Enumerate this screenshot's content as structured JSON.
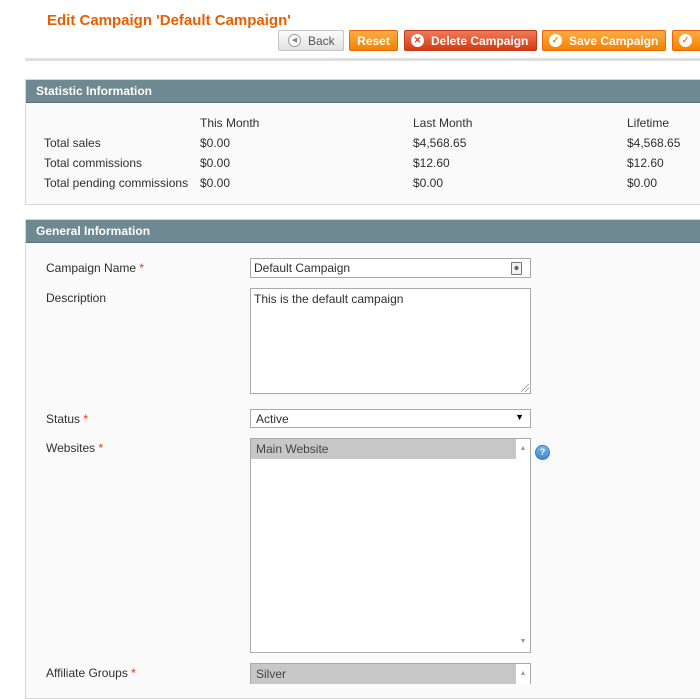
{
  "page": {
    "title": "Edit Campaign 'Default Campaign'"
  },
  "toolbar": {
    "back_label": "Back",
    "reset_label": "Reset",
    "delete_label": "Delete Campaign",
    "save_label": "Save Campaign"
  },
  "statistics": {
    "header": "Statistic Information",
    "columns": [
      "This Month",
      "Last Month",
      "Lifetime"
    ],
    "rows": [
      {
        "label": "Total sales",
        "values": [
          "$0.00",
          "$4,568.65",
          "$4,568.65"
        ]
      },
      {
        "label": "Total commissions",
        "values": [
          "$0.00",
          "$12.60",
          "$12.60"
        ]
      },
      {
        "label": "Total pending commissions",
        "values": [
          "$0.00",
          "$0.00",
          "$0.00"
        ]
      }
    ]
  },
  "general": {
    "header": "General Information",
    "required_mark": "*",
    "campaign_name": {
      "label": "Campaign Name",
      "value": "Default Campaign"
    },
    "description": {
      "label": "Description",
      "value": "This is the default campaign"
    },
    "status": {
      "label": "Status",
      "value": "Active"
    },
    "websites": {
      "label": "Websites",
      "options": [
        "Main Website"
      ]
    },
    "affiliate_groups": {
      "label": "Affiliate Groups",
      "options": [
        "Silver"
      ]
    }
  },
  "colors": {
    "title": "#eb5e00",
    "button_orange": "#f18200",
    "button_delete": "#d33b12",
    "section_header": "#6f8992",
    "required": "#eb340a"
  },
  "icons": {
    "back": "back-arrow-icon",
    "delete": "delete-x-icon",
    "save": "check-icon",
    "autofill": "contact-card-icon",
    "help": "help-question-icon"
  }
}
